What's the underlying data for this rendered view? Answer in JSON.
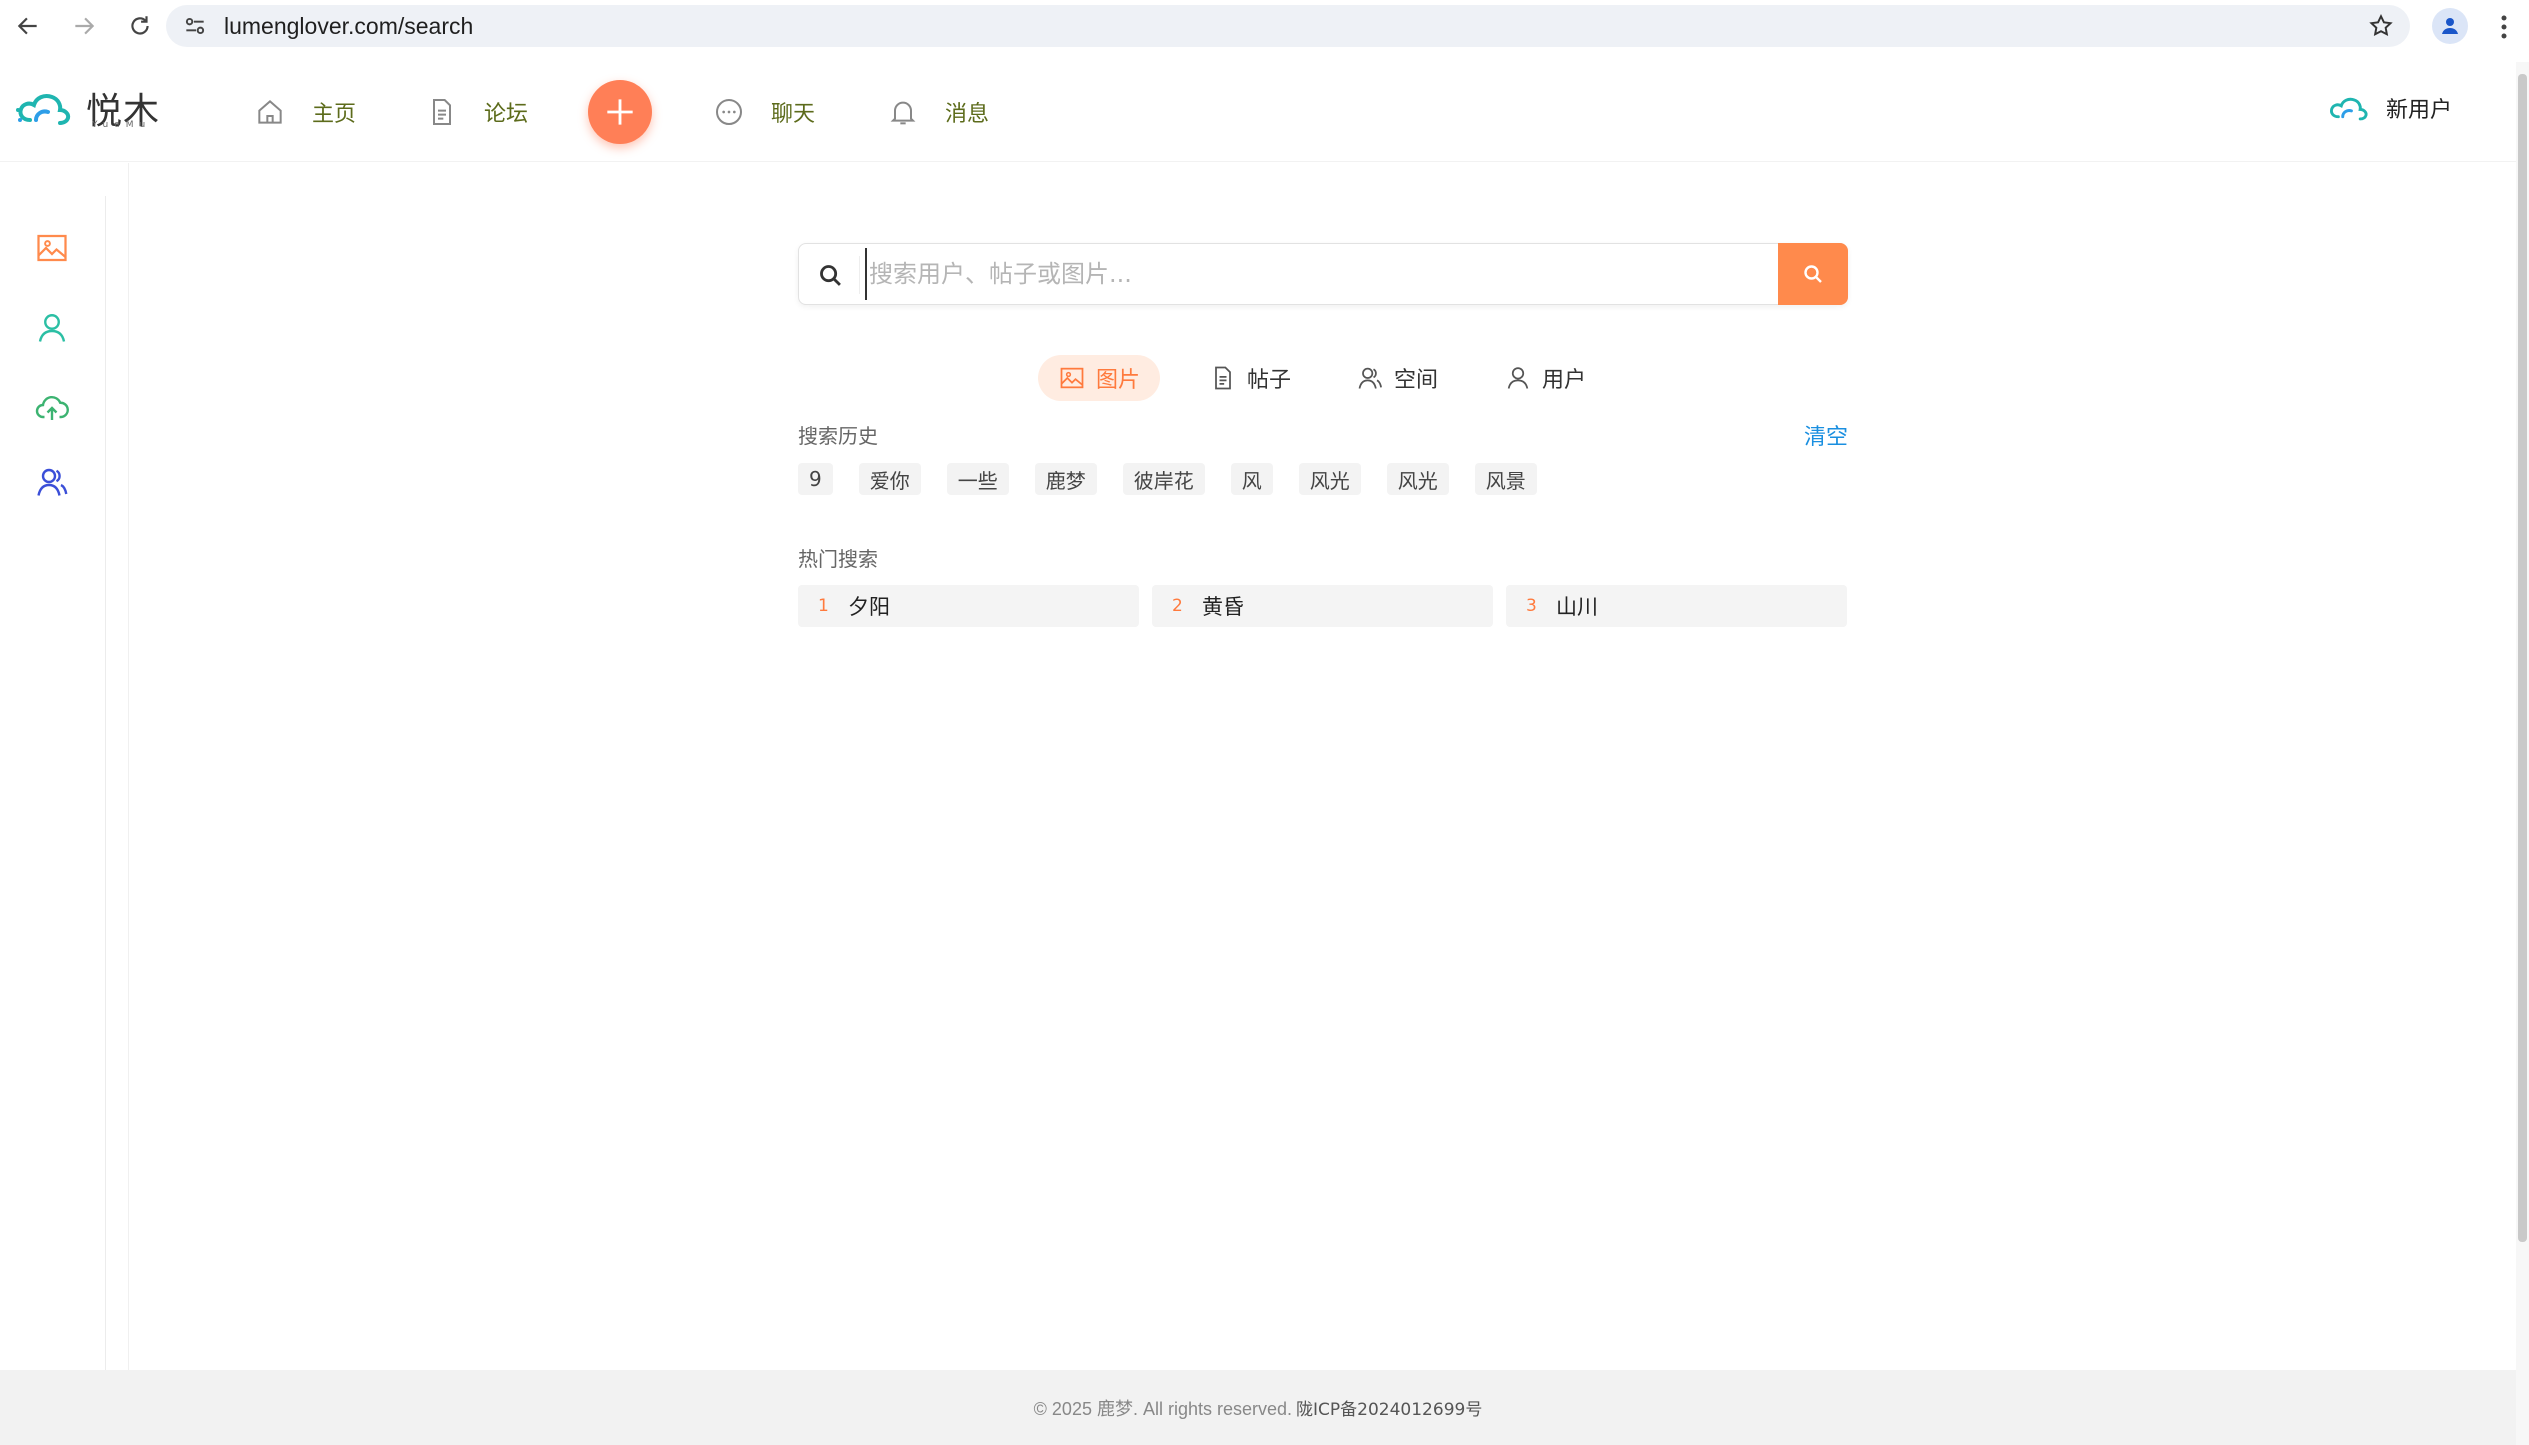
{
  "browser": {
    "url": "lumenglover.com/search"
  },
  "header": {
    "logo_text": "悦木",
    "logo_sub": "YueMu",
    "nav": [
      {
        "label": "主页",
        "icon": "home-icon"
      },
      {
        "label": "论坛",
        "icon": "document-icon"
      },
      {
        "label": "聊天",
        "icon": "chat-icon"
      },
      {
        "label": "消息",
        "icon": "bell-icon"
      }
    ],
    "user_name": "新用户"
  },
  "sidebar": {
    "items": [
      {
        "icon": "image-icon",
        "color": "#ff8a4c"
      },
      {
        "icon": "user-icon",
        "color": "#2bbfa4"
      },
      {
        "icon": "upload-cloud-icon",
        "color": "#3cb371"
      },
      {
        "icon": "users-icon",
        "color": "#3b4fd8"
      }
    ]
  },
  "search": {
    "placeholder": "搜索用户、帖子或图片...",
    "value": ""
  },
  "tabs": [
    {
      "label": "图片",
      "icon": "image-icon",
      "active": true
    },
    {
      "label": "帖子",
      "icon": "document-icon",
      "active": false
    },
    {
      "label": "空间",
      "icon": "space-users-icon",
      "active": false
    },
    {
      "label": "用户",
      "icon": "user-icon",
      "active": false
    }
  ],
  "history": {
    "title": "搜索历史",
    "clear_label": "清空",
    "tags": [
      "9",
      "爱你",
      "一些",
      "鹿梦",
      "彼岸花",
      "风",
      "风光",
      "风光",
      "风景"
    ]
  },
  "hot": {
    "title": "热门搜索",
    "items": [
      {
        "rank": "1",
        "term": "夕阳"
      },
      {
        "rank": "2",
        "term": "黄昏"
      },
      {
        "rank": "3",
        "term": "山川"
      }
    ]
  },
  "footer": {
    "copyright": "© 2025 鹿梦. All rights reserved.",
    "icp": "陇ICP备2024012699号"
  },
  "colors": {
    "accent": "#ff8a4c",
    "nav_label": "#5c6b1b",
    "link": "#1a8fe0"
  }
}
